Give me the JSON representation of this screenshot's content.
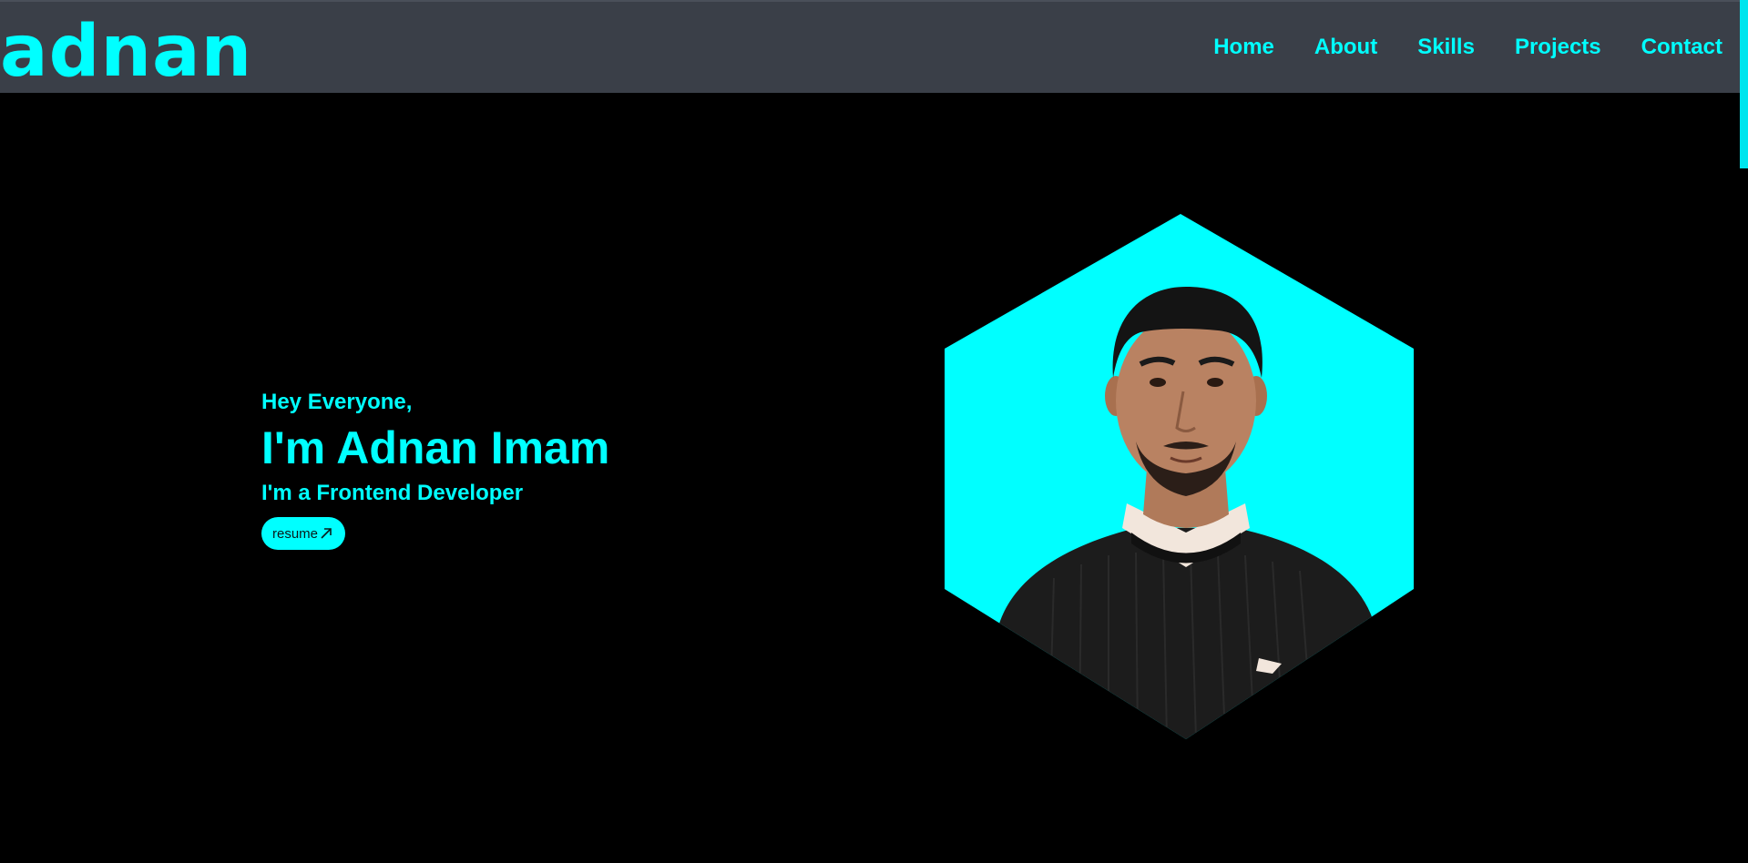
{
  "header": {
    "logo_text": "adnan",
    "nav": [
      {
        "label": "Home"
      },
      {
        "label": "About"
      },
      {
        "label": "Skills"
      },
      {
        "label": "Projects"
      },
      {
        "label": "Contact"
      }
    ]
  },
  "hero": {
    "greeting": "Hey Everyone,",
    "name": "I'm Adnan Imam",
    "role": "I'm a Frontend Developer",
    "resume_label": "resume",
    "resume_icon": "arrow-up-right-icon"
  },
  "colors": {
    "accent": "#00ffff",
    "navbar_bg": "#3a3f48",
    "page_bg": "#000000"
  }
}
